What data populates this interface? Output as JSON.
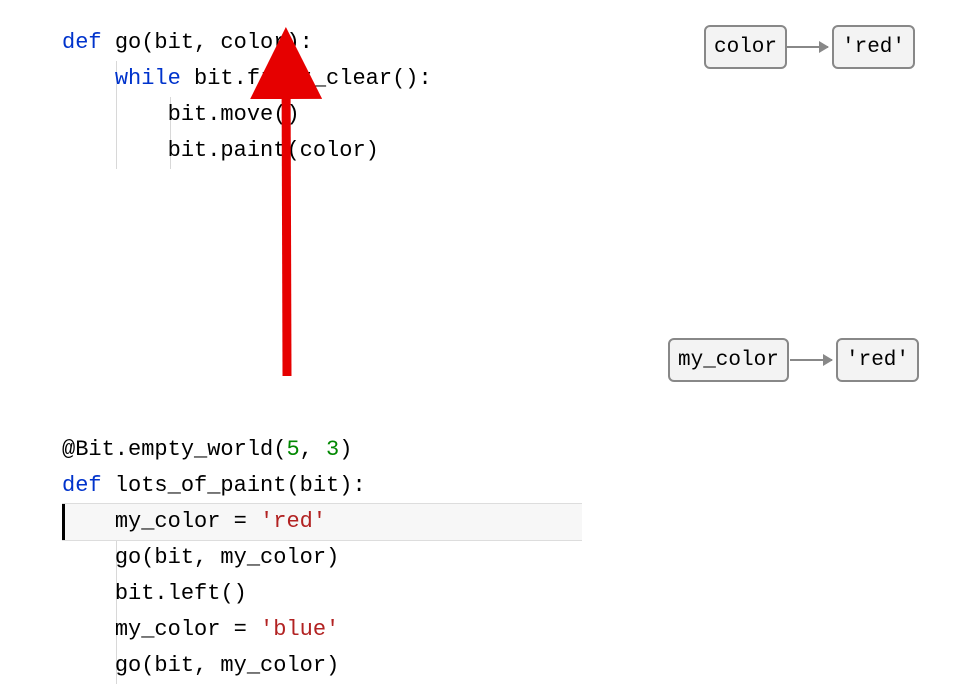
{
  "code_block_1": {
    "l1": {
      "def": "def ",
      "name": "go",
      "open": "(",
      "params": "bit, color",
      "close": "):",
      "full_params_close": "):"
    },
    "l2": {
      "indent": "    ",
      "kw": "while ",
      "call": "bit.front_clear",
      "paren": "():"
    },
    "l3": {
      "indent": "        ",
      "call": "bit.move",
      "paren": "()"
    },
    "l4": {
      "indent": "        ",
      "call": "bit.paint",
      "open": "(",
      "arg": "color",
      "close": ")"
    }
  },
  "code_block_2": {
    "l1": {
      "dec": "@Bit.empty_world",
      "open": "(",
      "a1": "5",
      "comma": ", ",
      "a2": "3",
      "close": ")"
    },
    "l2": {
      "def": "def ",
      "name": "lots_of_paint",
      "open": "(",
      "params": "bit",
      "close": "):"
    },
    "l3": {
      "indent": "    ",
      "lhs": "my_color = ",
      "str": "'red'"
    },
    "l4": {
      "indent": "    ",
      "call": "go",
      "open": "(",
      "args": "bit, my_color",
      "close": ")"
    },
    "l5": {
      "indent": "    ",
      "call": "bit.left",
      "paren": "()"
    },
    "l6": {
      "indent": "    ",
      "lhs": "my_color = ",
      "str": "'blue'"
    },
    "l7": {
      "indent": "    ",
      "call": "go",
      "open": "(",
      "args": "bit, my_color",
      "close": ")"
    }
  },
  "diagram_top": {
    "left_label": "color",
    "right_label": "'red'"
  },
  "diagram_bottom": {
    "left_label": "my_color",
    "right_label": "'red'"
  }
}
